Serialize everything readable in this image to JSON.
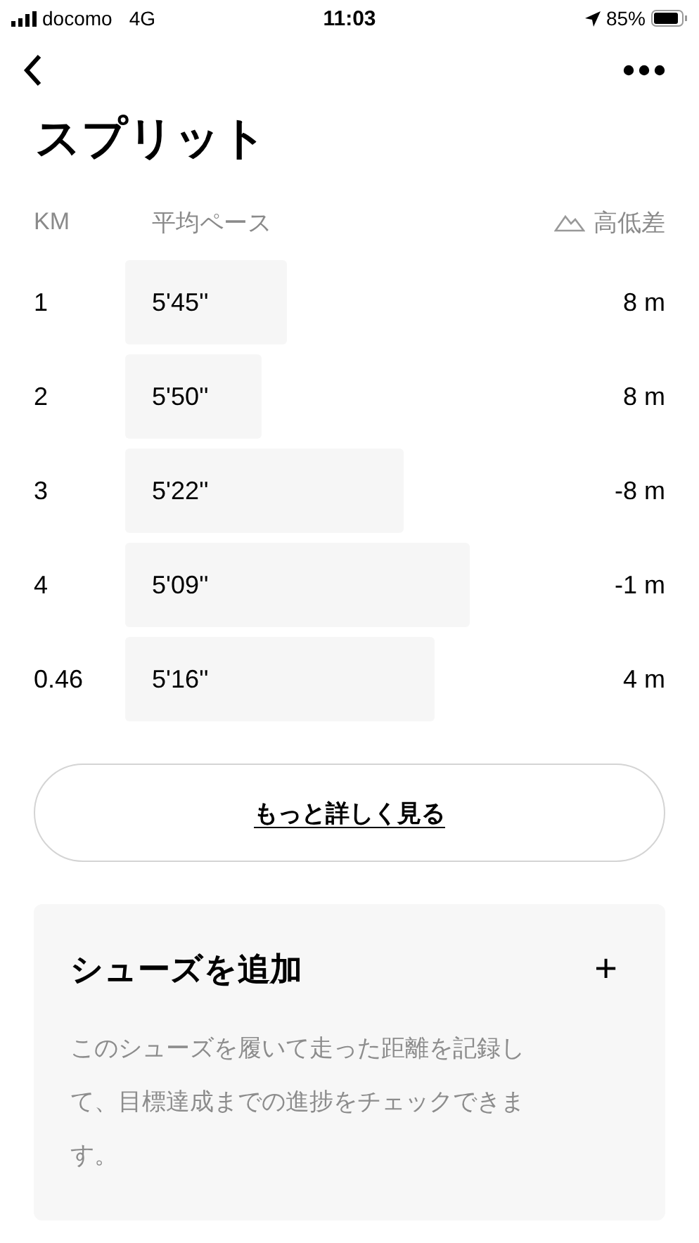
{
  "status_bar": {
    "carrier": "docomo",
    "network": "4G",
    "time": "11:03",
    "battery": "85%"
  },
  "title": "スプリット",
  "table": {
    "columns": [
      "KM",
      "平均ペース",
      "高低差"
    ],
    "rows": [
      {
        "km": "1",
        "pace": "5'45''",
        "elevation": "8 m"
      },
      {
        "km": "2",
        "pace": "5'50''",
        "elevation": "8 m"
      },
      {
        "km": "3",
        "pace": "5'22''",
        "elevation": "-8 m"
      },
      {
        "km": "4",
        "pace": "5'09''",
        "elevation": "-1 m"
      },
      {
        "km": "0.46",
        "pace": "5'16''",
        "elevation": "4 m"
      }
    ]
  },
  "more_button": "もっと詳しく見る",
  "shoes_card": {
    "title": "シューズを追加",
    "add": "+",
    "description": "このシューズを履いて走った距離を記録して、目標達成までの進捗をチェックできます。"
  }
}
